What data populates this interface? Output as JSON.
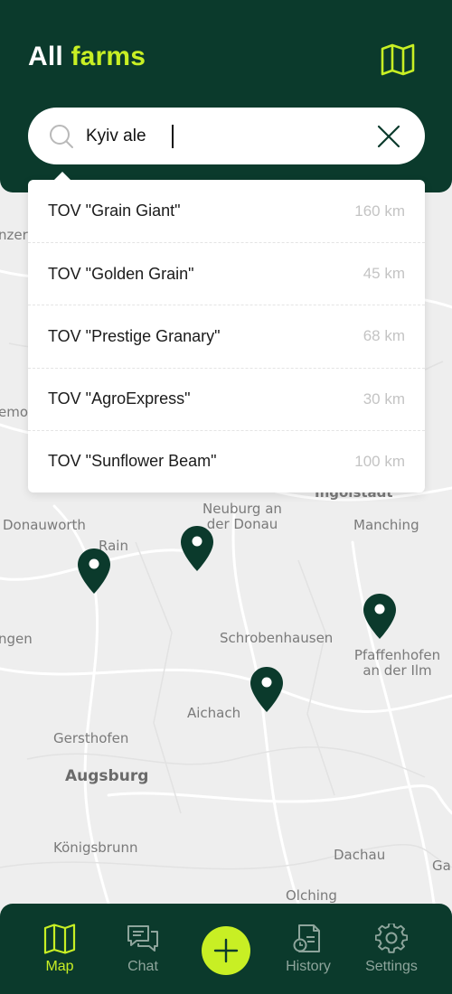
{
  "header": {
    "title_prefix": "All",
    "title_accent": "farms",
    "map_toggle_icon": "map-icon"
  },
  "search": {
    "value": "Kyiv ale",
    "icon": "search-icon",
    "clear_icon": "close-icon"
  },
  "results": [
    {
      "name": "TOV \"Grain Giant\"",
      "distance": "160 km"
    },
    {
      "name": "TOV \"Golden Grain\"",
      "distance": "45 km"
    },
    {
      "name": "TOV \"Prestige Granary\"",
      "distance": "68 km"
    },
    {
      "name": "TOV \"AgroExpress\"",
      "distance": "30 km"
    },
    {
      "name": "TOV \"Sunflower Beam\"",
      "distance": "100 km"
    }
  ],
  "map": {
    "labels": {
      "donauworth": "Donauworth",
      "rain": "Rain",
      "neuburg_1": "Neuburg an",
      "neuburg_2": "der Donau",
      "ingolstadt": "Ingolstadt",
      "manching": "Manching",
      "schrobenhausen": "Schrobenhausen",
      "pfaffenhofen_1": "Pfaffenhofen",
      "pfaffenhofen_2": "an der Ilm",
      "aichach": "Aichach",
      "gersthofen": "Gersthofen",
      "augsburg": "Augsburg",
      "konigsbrunn": "Königsbrunn",
      "dachau": "Dachau",
      "olching": "Olching",
      "edge_nzer": "nzer",
      "edge_emo": "emo",
      "edge_ngen": "ngen",
      "edge_ga": "Ga"
    },
    "pin_icon": "map-pin-icon"
  },
  "nav": {
    "items": [
      {
        "label": "Map",
        "icon": "map-icon"
      },
      {
        "label": "Chat",
        "icon": "chat-icon"
      },
      {
        "label": "History",
        "icon": "history-icon"
      },
      {
        "label": "Settings",
        "icon": "gear-icon"
      }
    ],
    "add_icon": "plus-icon"
  },
  "colors": {
    "primary_dark": "#0b3a2c",
    "accent": "#c8ef24",
    "nav_inactive": "#8ea59c"
  }
}
